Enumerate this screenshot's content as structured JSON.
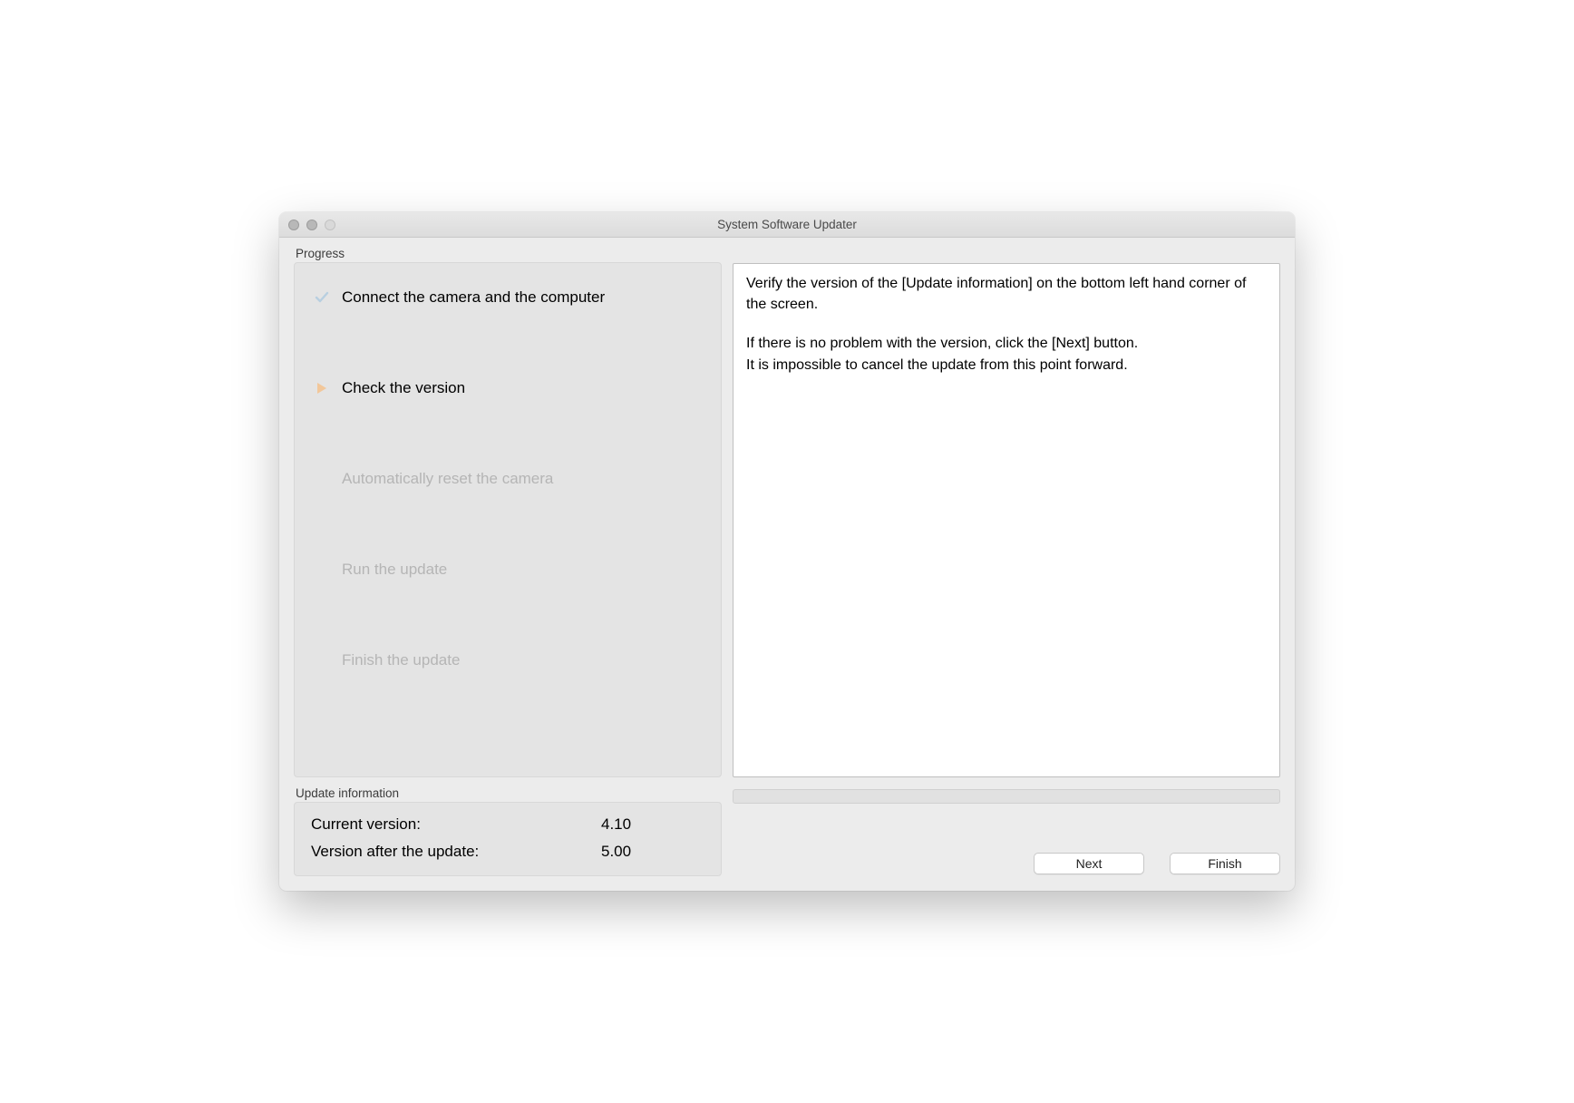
{
  "window": {
    "title": "System Software Updater"
  },
  "progress": {
    "label": "Progress",
    "steps": [
      {
        "label": "Connect the camera and the computer",
        "state": "done"
      },
      {
        "label": "Check the version",
        "state": "current"
      },
      {
        "label": "Automatically reset the camera",
        "state": "pending"
      },
      {
        "label": "Run the update",
        "state": "pending"
      },
      {
        "label": "Finish the update",
        "state": "pending"
      }
    ]
  },
  "instructions": {
    "p1": "Verify the version of the [Update information] on the bottom left hand corner of the screen.",
    "p2": "If there is no problem with the version, click the [Next] button.",
    "p3": "It is impossible to cancel the update from this point forward."
  },
  "updateInfo": {
    "label": "Update information",
    "currentLabel": "Current version:",
    "currentValue": "4.10",
    "afterLabel": "Version after the update:",
    "afterValue": "5.00"
  },
  "buttons": {
    "next": "Next",
    "finish": "Finish"
  }
}
